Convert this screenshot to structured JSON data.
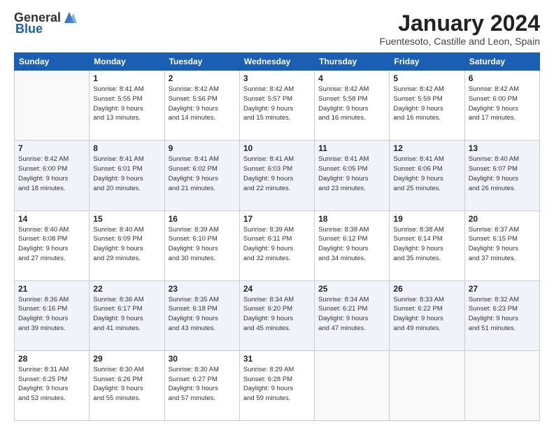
{
  "header": {
    "logo_general": "General",
    "logo_blue": "Blue",
    "month_title": "January 2024",
    "location": "Fuentesoto, Castille and Leon, Spain"
  },
  "calendar": {
    "weekdays": [
      "Sunday",
      "Monday",
      "Tuesday",
      "Wednesday",
      "Thursday",
      "Friday",
      "Saturday"
    ],
    "weeks": [
      [
        {
          "day": "",
          "content": ""
        },
        {
          "day": "1",
          "content": "Sunrise: 8:41 AM\nSunset: 5:55 PM\nDaylight: 9 hours\nand 13 minutes."
        },
        {
          "day": "2",
          "content": "Sunrise: 8:42 AM\nSunset: 5:56 PM\nDaylight: 9 hours\nand 14 minutes."
        },
        {
          "day": "3",
          "content": "Sunrise: 8:42 AM\nSunset: 5:57 PM\nDaylight: 9 hours\nand 15 minutes."
        },
        {
          "day": "4",
          "content": "Sunrise: 8:42 AM\nSunset: 5:58 PM\nDaylight: 9 hours\nand 16 minutes."
        },
        {
          "day": "5",
          "content": "Sunrise: 8:42 AM\nSunset: 5:59 PM\nDaylight: 9 hours\nand 16 minutes."
        },
        {
          "day": "6",
          "content": "Sunrise: 8:42 AM\nSunset: 6:00 PM\nDaylight: 9 hours\nand 17 minutes."
        }
      ],
      [
        {
          "day": "7",
          "content": "Sunrise: 8:42 AM\nSunset: 6:00 PM\nDaylight: 9 hours\nand 18 minutes."
        },
        {
          "day": "8",
          "content": "Sunrise: 8:41 AM\nSunset: 6:01 PM\nDaylight: 9 hours\nand 20 minutes."
        },
        {
          "day": "9",
          "content": "Sunrise: 8:41 AM\nSunset: 6:02 PM\nDaylight: 9 hours\nand 21 minutes."
        },
        {
          "day": "10",
          "content": "Sunrise: 8:41 AM\nSunset: 6:03 PM\nDaylight: 9 hours\nand 22 minutes."
        },
        {
          "day": "11",
          "content": "Sunrise: 8:41 AM\nSunset: 6:05 PM\nDaylight: 9 hours\nand 23 minutes."
        },
        {
          "day": "12",
          "content": "Sunrise: 8:41 AM\nSunset: 6:06 PM\nDaylight: 9 hours\nand 25 minutes."
        },
        {
          "day": "13",
          "content": "Sunrise: 8:40 AM\nSunset: 6:07 PM\nDaylight: 9 hours\nand 26 minutes."
        }
      ],
      [
        {
          "day": "14",
          "content": "Sunrise: 8:40 AM\nSunset: 6:08 PM\nDaylight: 9 hours\nand 27 minutes."
        },
        {
          "day": "15",
          "content": "Sunrise: 8:40 AM\nSunset: 6:09 PM\nDaylight: 9 hours\nand 29 minutes."
        },
        {
          "day": "16",
          "content": "Sunrise: 8:39 AM\nSunset: 6:10 PM\nDaylight: 9 hours\nand 30 minutes."
        },
        {
          "day": "17",
          "content": "Sunrise: 8:39 AM\nSunset: 6:11 PM\nDaylight: 9 hours\nand 32 minutes."
        },
        {
          "day": "18",
          "content": "Sunrise: 8:38 AM\nSunset: 6:12 PM\nDaylight: 9 hours\nand 34 minutes."
        },
        {
          "day": "19",
          "content": "Sunrise: 8:38 AM\nSunset: 6:14 PM\nDaylight: 9 hours\nand 35 minutes."
        },
        {
          "day": "20",
          "content": "Sunrise: 8:37 AM\nSunset: 6:15 PM\nDaylight: 9 hours\nand 37 minutes."
        }
      ],
      [
        {
          "day": "21",
          "content": "Sunrise: 8:36 AM\nSunset: 6:16 PM\nDaylight: 9 hours\nand 39 minutes."
        },
        {
          "day": "22",
          "content": "Sunrise: 8:36 AM\nSunset: 6:17 PM\nDaylight: 9 hours\nand 41 minutes."
        },
        {
          "day": "23",
          "content": "Sunrise: 8:35 AM\nSunset: 6:18 PM\nDaylight: 9 hours\nand 43 minutes."
        },
        {
          "day": "24",
          "content": "Sunrise: 8:34 AM\nSunset: 6:20 PM\nDaylight: 9 hours\nand 45 minutes."
        },
        {
          "day": "25",
          "content": "Sunrise: 8:34 AM\nSunset: 6:21 PM\nDaylight: 9 hours\nand 47 minutes."
        },
        {
          "day": "26",
          "content": "Sunrise: 8:33 AM\nSunset: 6:22 PM\nDaylight: 9 hours\nand 49 minutes."
        },
        {
          "day": "27",
          "content": "Sunrise: 8:32 AM\nSunset: 6:23 PM\nDaylight: 9 hours\nand 51 minutes."
        }
      ],
      [
        {
          "day": "28",
          "content": "Sunrise: 8:31 AM\nSunset: 6:25 PM\nDaylight: 9 hours\nand 53 minutes."
        },
        {
          "day": "29",
          "content": "Sunrise: 8:30 AM\nSunset: 6:26 PM\nDaylight: 9 hours\nand 55 minutes."
        },
        {
          "day": "30",
          "content": "Sunrise: 8:30 AM\nSunset: 6:27 PM\nDaylight: 9 hours\nand 57 minutes."
        },
        {
          "day": "31",
          "content": "Sunrise: 8:29 AM\nSunset: 6:28 PM\nDaylight: 9 hours\nand 59 minutes."
        },
        {
          "day": "",
          "content": ""
        },
        {
          "day": "",
          "content": ""
        },
        {
          "day": "",
          "content": ""
        }
      ]
    ]
  }
}
